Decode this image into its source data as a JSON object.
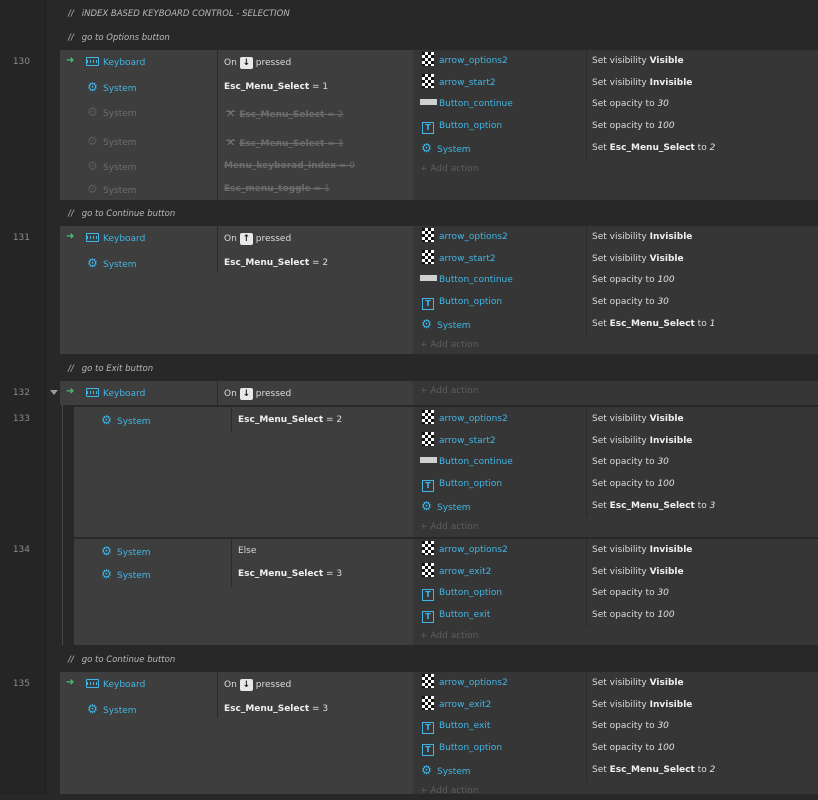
{
  "header_comment": "iNDEX BASED KEYBOARD CONTROL - SELECTION",
  "comment_prefix": "//",
  "add_action_label": "Add action",
  "icons": {
    "keyboard": "keyboard-icon",
    "system": "gear-icon",
    "sprite": "checkerboard-sprite-icon",
    "text": "text-object-icon",
    "spritefont": "spritefont-icon"
  },
  "colors": {
    "object_link": "#41b6e6",
    "trigger_arrow": "#43c46b",
    "background": "#282828"
  },
  "groups": [
    {
      "comment": "go to Options button",
      "line": "130",
      "conditions": [
        {
          "object": "Keyboard",
          "pre": "On",
          "key": "↓",
          "post": "pressed"
        },
        {
          "object": "System",
          "var": "Esc_Menu_Select",
          "op": "= 1"
        },
        {
          "object": "System",
          "var": "Esc_Menu_Select",
          "op": "= 2"
        },
        {
          "object": "System",
          "var": "Esc_Menu_Select",
          "op": "= 3"
        },
        {
          "object": "System",
          "var": "Menu_keyborad_index",
          "op": "= 0"
        },
        {
          "object": "System",
          "var": "Esc_menu_toggle",
          "op": "= 1"
        }
      ],
      "actions": [
        {
          "object": "arrow_options2",
          "pre": "Set visibility",
          "val": "Visible"
        },
        {
          "object": "arrow_start2",
          "pre": "Set visibility",
          "val": "Invisible"
        },
        {
          "object": "Button_continue",
          "pre": "Set opacity to",
          "val": "30"
        },
        {
          "object": "Button_option",
          "pre": "Set opacity to",
          "val": "100"
        },
        {
          "object": "System",
          "pre": "Set",
          "var": "Esc_Menu_Select",
          "mid": "to",
          "val": "2"
        }
      ]
    },
    {
      "comment": "go to Continue button",
      "line": "131",
      "conditions": [
        {
          "object": "Keyboard",
          "pre": "On",
          "key": "↑",
          "post": "pressed"
        },
        {
          "object": "System",
          "var": "Esc_Menu_Select",
          "op": "= 2"
        }
      ],
      "actions": [
        {
          "object": "arrow_options2",
          "pre": "Set visibility",
          "val": "Invisible"
        },
        {
          "object": "arrow_start2",
          "pre": "Set visibility",
          "val": "Visible"
        },
        {
          "object": "Button_continue",
          "pre": "Set opacity to",
          "val": "100"
        },
        {
          "object": "Button_option",
          "pre": "Set opacity to",
          "val": "30"
        },
        {
          "object": "System",
          "pre": "Set",
          "var": "Esc_Menu_Select",
          "mid": "to",
          "val": "1"
        }
      ]
    },
    {
      "comment": "go to Exit button",
      "line": "132",
      "conditions": [
        {
          "object": "Keyboard",
          "pre": "On",
          "key": "↓",
          "post": "pressed"
        }
      ]
    },
    {
      "line": "133",
      "conditions": [
        {
          "object": "System",
          "var": "Esc_Menu_Select",
          "op": "= 2"
        }
      ],
      "actions": [
        {
          "object": "arrow_options2",
          "pre": "Set visibility",
          "val": "Visible"
        },
        {
          "object": "arrow_start2",
          "pre": "Set visibility",
          "val": "Invisible"
        },
        {
          "object": "Button_continue",
          "pre": "Set opacity to",
          "val": "30"
        },
        {
          "object": "Button_option",
          "pre": "Set opacity to",
          "val": "100"
        },
        {
          "object": "System",
          "pre": "Set",
          "var": "Esc_Menu_Select",
          "mid": "to",
          "val": "3"
        }
      ]
    },
    {
      "line": "134",
      "conditions": [
        {
          "object": "System",
          "text": "Else"
        },
        {
          "object": "System",
          "var": "Esc_Menu_Select",
          "op": "= 3"
        }
      ],
      "actions": [
        {
          "object": "arrow_options2",
          "pre": "Set visibility",
          "val": "Invisible"
        },
        {
          "object": "arrow_exit2",
          "pre": "Set visibility",
          "val": "Visible"
        },
        {
          "object": "Button_option",
          "pre": "Set opacity to",
          "val": "30"
        },
        {
          "object": "Button_exit",
          "pre": "Set opacity to",
          "val": "100"
        }
      ]
    },
    {
      "comment": "go to Continue button",
      "line": "135",
      "conditions": [
        {
          "object": "Keyboard",
          "pre": "On",
          "key": "↓",
          "post": "pressed"
        },
        {
          "object": "System",
          "var": "Esc_Menu_Select",
          "op": "= 3"
        }
      ],
      "actions": [
        {
          "object": "arrow_options2",
          "pre": "Set visibility",
          "val": "Visible"
        },
        {
          "object": "arrow_exit2",
          "pre": "Set visibility",
          "val": "Invisible"
        },
        {
          "object": "Button_exit",
          "pre": "Set opacity to",
          "val": "30"
        },
        {
          "object": "Button_option",
          "pre": "Set opacity to",
          "val": "100"
        },
        {
          "object": "System",
          "pre": "Set",
          "var": "Esc_Menu_Select",
          "mid": "to",
          "val": "2"
        }
      ]
    }
  ]
}
